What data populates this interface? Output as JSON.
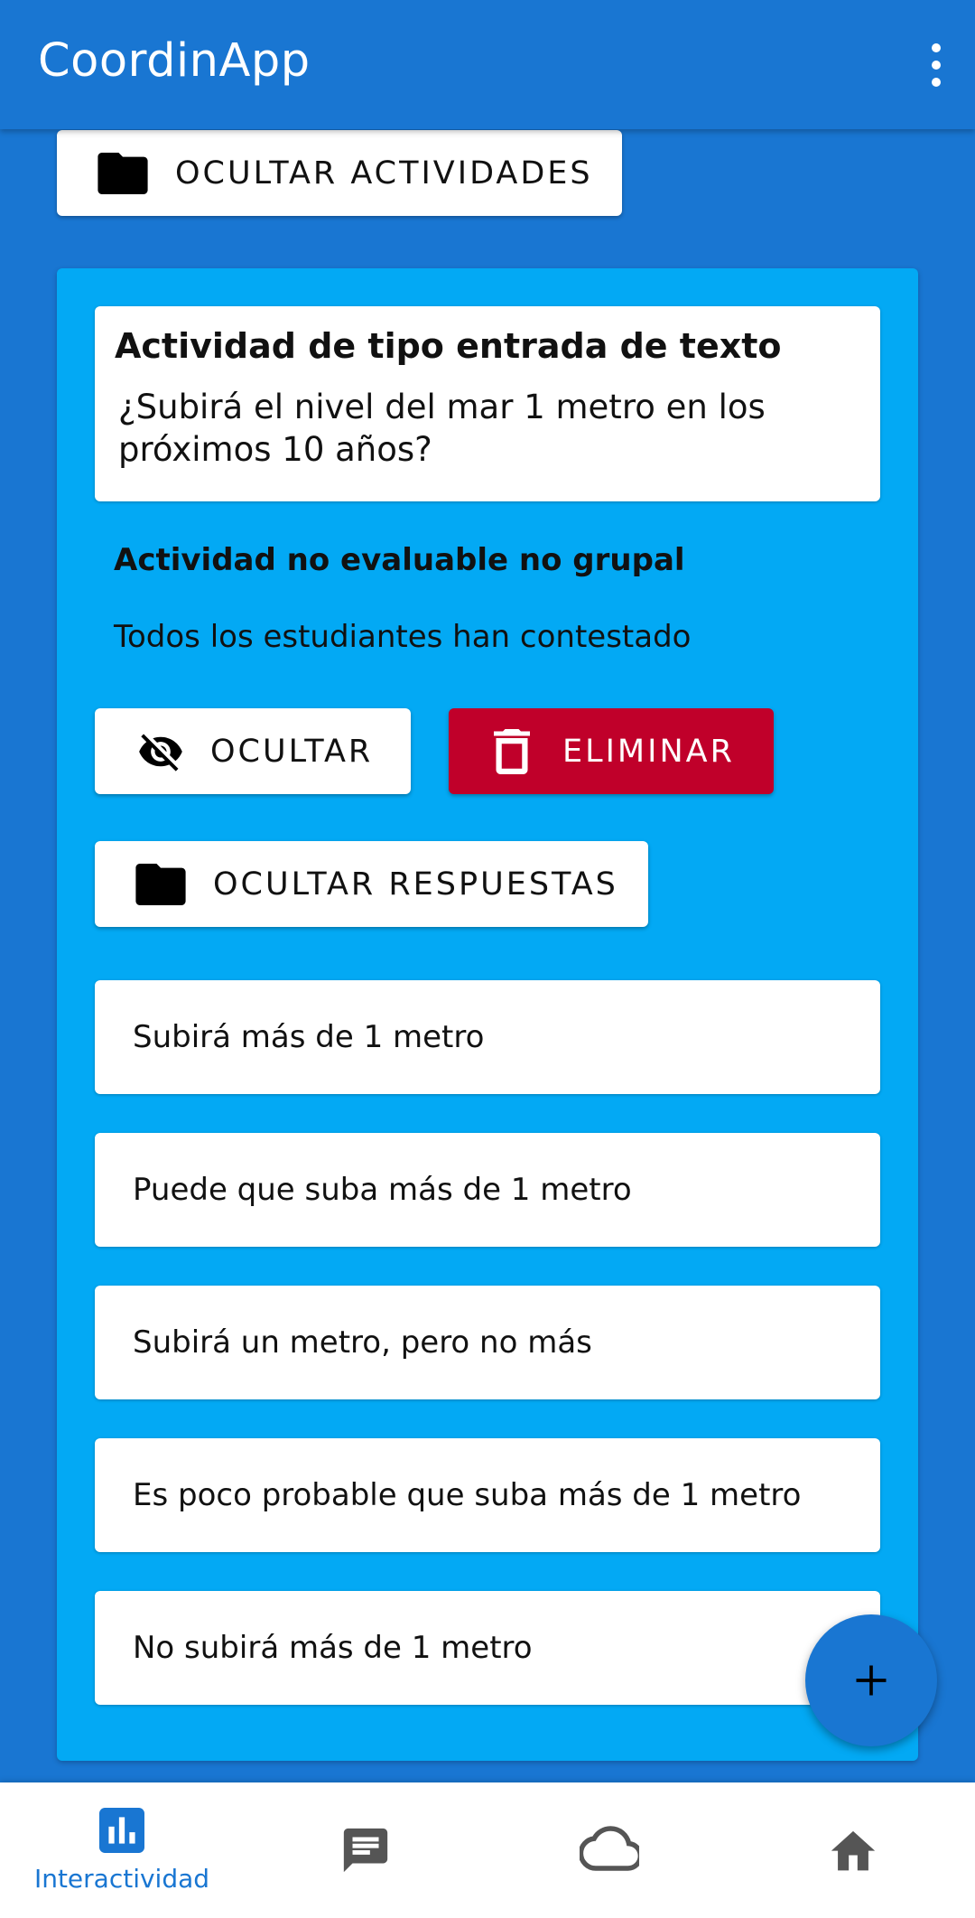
{
  "app": {
    "title": "CoordinApp"
  },
  "toolbar": {
    "hide_activities_label": "OCULTAR ACTIVIDADES"
  },
  "activity": {
    "title": "Actividad de tipo entrada de texto",
    "question": "¿Subirá el nivel del mar 1 metro en los próximos 10 años?",
    "type_label": "Actividad no evaluable no grupal",
    "status": "Todos los estudiantes han contestado",
    "hide_label": "OCULTAR",
    "delete_label": "ELIMINAR",
    "hide_answers_label": "OCULTAR RESPUESTAS",
    "answers": [
      "Subirá más de 1 metro",
      "Puede que suba más de 1 metro",
      "Subirá un metro, pero no más",
      "Es poco probable que suba más de 1 metro",
      "No subirá más de 1 metro"
    ]
  },
  "bottom_nav": {
    "items": [
      {
        "label": "Interactividad",
        "icon": "bar-chart-icon",
        "active": true
      },
      {
        "label": "",
        "icon": "chat-icon"
      },
      {
        "label": "",
        "icon": "cloud-icon"
      },
      {
        "label": "",
        "icon": "home-icon"
      }
    ]
  },
  "colors": {
    "primary": "#1976d2",
    "panel": "#03a9f4",
    "danger": "#c0002a",
    "surface": "#ffffff"
  },
  "icons": {
    "menu": "more-vert-icon",
    "folder": "folder-icon",
    "visibility_off": "visibility-off-icon",
    "delete": "trash-icon",
    "fab": "add-icon"
  }
}
